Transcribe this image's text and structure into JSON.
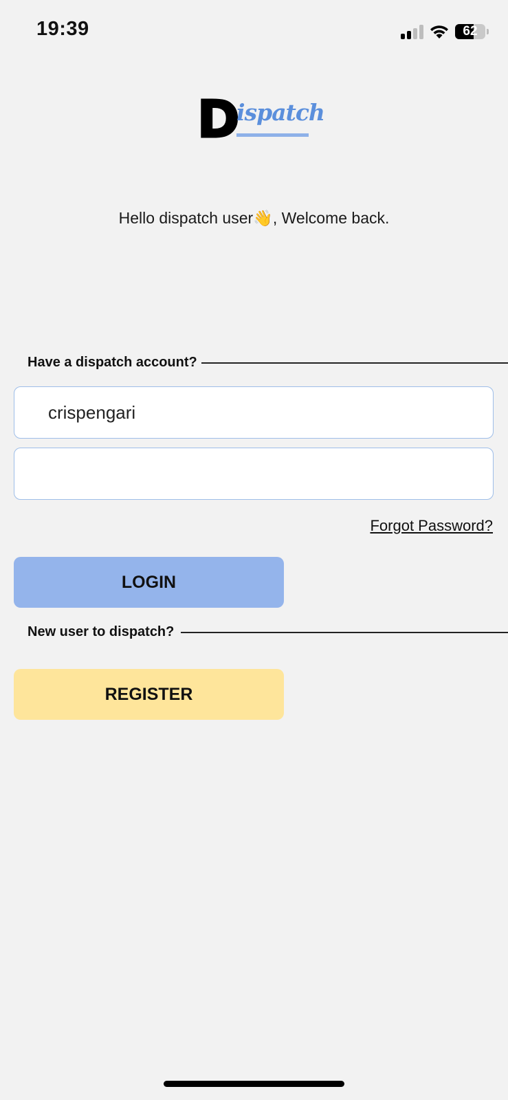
{
  "status_bar": {
    "time": "19:39",
    "battery_level": "62",
    "battery_fraction": 0.62,
    "signal_bars_active": 2,
    "icons": [
      "cellular-signal-icon",
      "wifi-icon",
      "battery-icon"
    ]
  },
  "logo": {
    "letter": "D",
    "rest": "ispatch",
    "accent_color": "#5b8fdc"
  },
  "greeting": {
    "before": "Hello dispatch user",
    "emoji": "👋",
    "after": ", Welcome back."
  },
  "login_section": {
    "heading": "Have a dispatch account?",
    "username_value": "crispengari",
    "password_value": "",
    "forgot_label": "Forgot Password?",
    "login_label": "LOGIN",
    "login_color": "#94b4eb"
  },
  "register_section": {
    "heading": "New user to dispatch?",
    "register_label": "REGISTER",
    "register_color": "#fee59b"
  }
}
